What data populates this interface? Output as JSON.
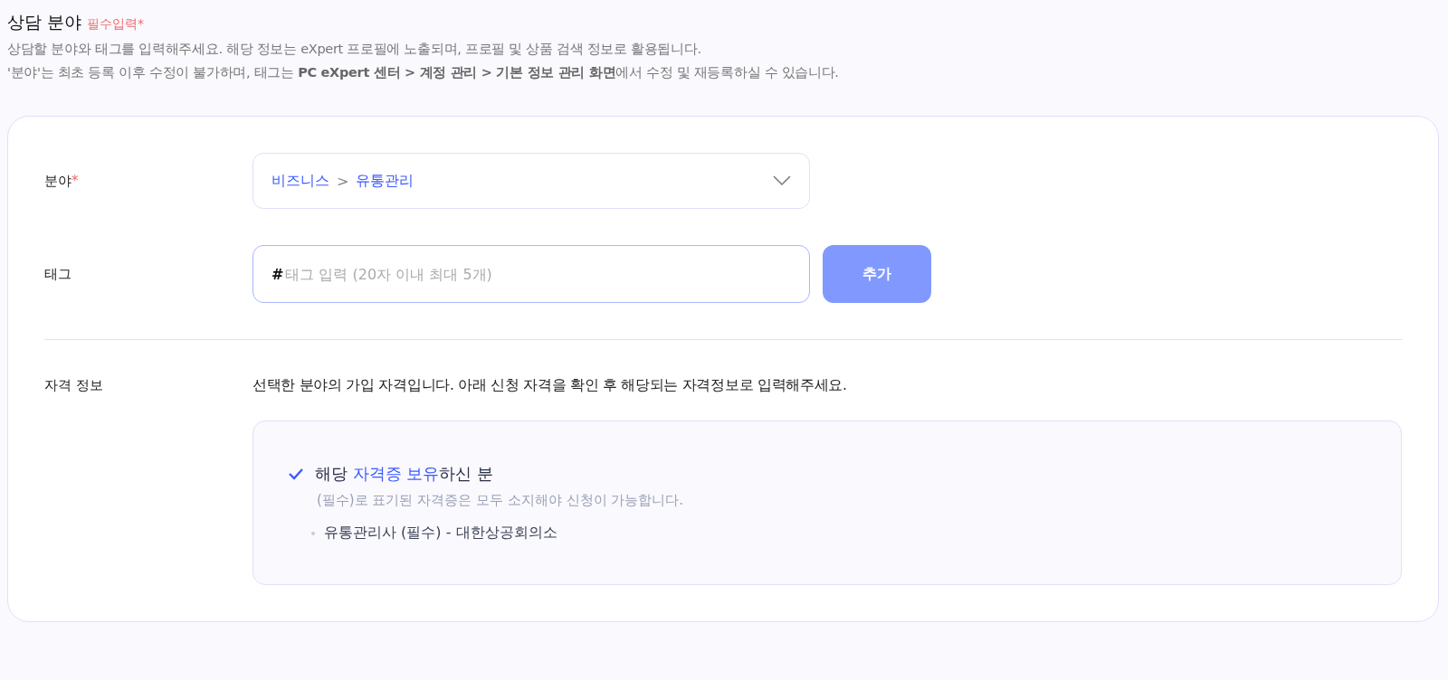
{
  "section": {
    "title": "상담 분야",
    "required_badge": "필수입력*",
    "description": [
      "상담할 분야와 태그를 입력해주세요. 해당 정보는 eXpert 프로필에 노출되며, 프로필 및 상품 검색 정보로 활용됩니다.",
      "'분야'는 최초 등록 이후 수정이 불가하며, 태그는 **PC eXpert 센터 > 계정 관리 > 기본 정보 관리 화면**에서 수정 및 재등록하실 수 있습니다."
    ]
  },
  "form": {
    "fields": [
      {
        "kind": "select",
        "label": "분야",
        "required_mark": "*",
        "path": [
          "비즈니스",
          "유통관리"
        ],
        "separator": ">"
      },
      {
        "kind": "tag",
        "label": "태그",
        "prefix": "#",
        "placeholder": "태그 입력 (20자 이내 최대 5개)",
        "button": "추가"
      }
    ],
    "qualification": {
      "label": "자격 정보",
      "intro": "선택한 분야의 가입 자격입니다. 아래 신청 자격을 확인 후 해당되는 자격정보로 입력해주세요.",
      "options": [
        {
          "checked": true,
          "title_parts": [
            {
              "text": "해당 ",
              "highlight": false
            },
            {
              "text": "자격증 보유",
              "highlight": true
            },
            {
              "text": "하신 분",
              "highlight": false
            }
          ],
          "note": "(필수)로 표기된 자격증은 모두 소지해야 신청이 가능합니다.",
          "items": [
            "유통관리사 (필수) - 대한상공회의소"
          ]
        }
      ]
    }
  }
}
